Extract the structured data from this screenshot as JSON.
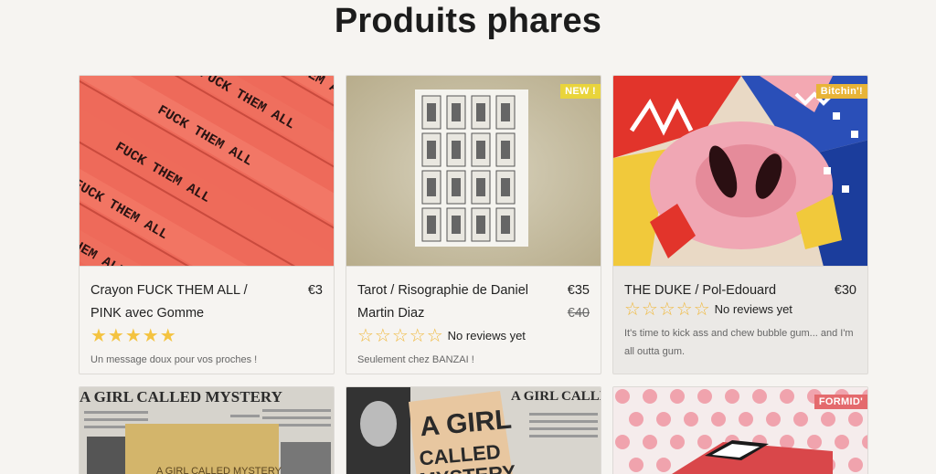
{
  "section_title": "Produits phares",
  "products": [
    {
      "name": "Crayon FUCK THEM ALL / PINK avec Gomme",
      "price": "€3",
      "rating_stars": 5,
      "stars_text": "★★★★★",
      "description": "Un message doux pour vos proches !",
      "image_icon": "pencils-image",
      "pencil_text": "FUCK THEM ALL"
    },
    {
      "name": "Tarot / Risographie de Daniel Martin Diaz",
      "price": "€35",
      "old_price": "€40",
      "badge": "NEW !",
      "stars_text": "☆☆☆☆☆",
      "reviews": "No reviews yet",
      "description": "Seulement chez BANZAI !",
      "image_icon": "tarot-print-image"
    },
    {
      "name": "THE DUKE / Pol-Edouard",
      "price": "€30",
      "badge": "Bitchin'!",
      "stars_text": "☆☆☆☆☆",
      "reviews": "No reviews yet",
      "description": "It's time to kick ass and chew bubble gum... and I'm all outta gum.",
      "image_icon": "duke-artwork-image"
    },
    {
      "image_icon": "mystery-book-image",
      "cover_text": "A GIRL CALLED MYSTERY"
    },
    {
      "image_icon": "mystery-book-image-2",
      "cover_text": "A GIRL CALLED MYSTERY"
    },
    {
      "badge": "FORMID'",
      "image_icon": "polka-dot-box-image"
    }
  ],
  "colors": {
    "background": "#f6f4f1",
    "star": "#f4c340",
    "badge_new": "#e9d43b",
    "badge_bitchin": "#e8b437",
    "badge_formid": "#e46a6d"
  }
}
